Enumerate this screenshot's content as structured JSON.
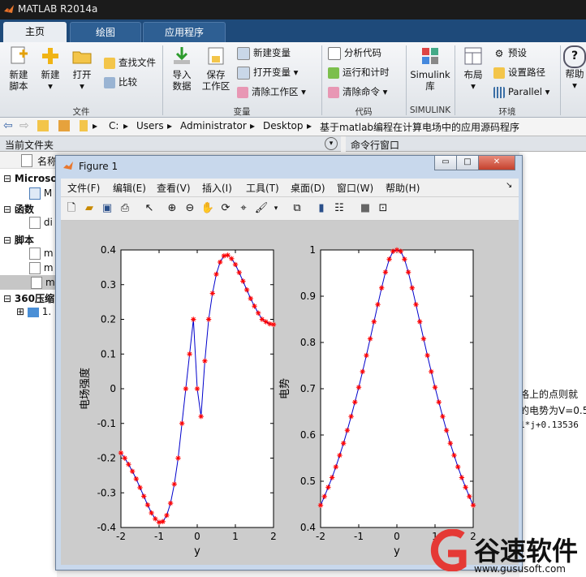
{
  "window": {
    "title": "MATLAB R2014a"
  },
  "tabs": [
    {
      "label": "主页",
      "active": true
    },
    {
      "label": "绘图",
      "active": false
    },
    {
      "label": "应用程序",
      "active": false
    }
  ],
  "ribbon": {
    "file_group": {
      "label": "文件",
      "new_script": "新建\n脚本",
      "new": "新建",
      "open": "打开",
      "find_files": "查找文件",
      "compare": "比较"
    },
    "variable_group": {
      "label": "变量",
      "import": "导入\n数据",
      "save_ws": "保存\n工作区",
      "new_var": "新建变量",
      "open_var": "打开变量",
      "clear_ws": "清除工作区"
    },
    "code_group": {
      "label": "代码",
      "analyze": "分析代码",
      "run_time": "运行和计时",
      "clear_cmd": "清除命令"
    },
    "simulink_group": {
      "label": "SIMULINK",
      "simulink": "Simulink\n库"
    },
    "env_group": {
      "label": "环境",
      "layout": "布局",
      "prefs": "预设",
      "set_path": "设置路径",
      "parallel": "Parallel"
    },
    "help": "帮助"
  },
  "address": {
    "crumbs": [
      "C:",
      "Users",
      "Administrator",
      "Desktop",
      "基于matlab编程在计算电场中的应用源码程序"
    ]
  },
  "left_pane": {
    "header": "当前文件夹",
    "name_col": "名称",
    "items": [
      {
        "label": "Microso"
      },
      {
        "label": "M"
      },
      {
        "label": "函数"
      },
      {
        "label": "di"
      },
      {
        "label": "脚本"
      },
      {
        "label": "m"
      },
      {
        "label": "m"
      },
      {
        "label": "m"
      },
      {
        "label": "360压缩"
      },
      {
        "label": "1."
      }
    ]
  },
  "command_window": {
    "header": "命令行窗口",
    "lines": [
      "格上的点则就",
      "的电势为V=0.5",
      "1*j+0.13536"
    ]
  },
  "figure": {
    "title": "Figure 1",
    "menu": [
      "文件(F)",
      "编辑(E)",
      "查看(V)",
      "插入(I)",
      "工具(T)",
      "桌面(D)",
      "窗口(W)",
      "帮助(H)"
    ],
    "minimize": "▭",
    "maximize": "□",
    "close": "✕"
  },
  "chart_data": [
    {
      "type": "line",
      "xlabel": "y",
      "ylabel": "电场强度",
      "xlim": [
        -2,
        2
      ],
      "ylim": [
        -0.4,
        0.4
      ],
      "xticks": [
        -2,
        -1,
        0,
        1,
        2
      ],
      "yticks": [
        -0.4,
        -0.3,
        -0.2,
        -0.1,
        0,
        0.1,
        0.2,
        0.3,
        0.4
      ],
      "grid": false,
      "line_color": "#0000cc",
      "marker_color": "#ff0000",
      "marker": "*",
      "x": [
        -2.0,
        -1.9,
        -1.8,
        -1.7,
        -1.6,
        -1.5,
        -1.4,
        -1.3,
        -1.2,
        -1.1,
        -1.0,
        -0.9,
        -0.8,
        -0.7,
        -0.6,
        -0.5,
        -0.4,
        -0.3,
        -0.2,
        -0.1,
        0.0,
        0.1,
        0.2,
        0.3,
        0.4,
        0.5,
        0.6,
        0.7,
        0.8,
        0.9,
        1.0,
        1.1,
        1.2,
        1.3,
        1.4,
        1.5,
        1.6,
        1.7,
        1.8,
        1.9,
        2.0
      ],
      "y": [
        -0.185,
        -0.2,
        -0.218,
        -0.238,
        -0.26,
        -0.285,
        -0.31,
        -0.335,
        -0.358,
        -0.375,
        -0.385,
        -0.383,
        -0.365,
        -0.33,
        -0.275,
        -0.2,
        -0.1,
        0.0,
        0.1,
        0.2,
        0.0,
        -0.08,
        0.08,
        0.2,
        0.275,
        0.33,
        0.365,
        0.383,
        0.385,
        0.375,
        0.358,
        0.335,
        0.31,
        0.285,
        0.26,
        0.238,
        0.218,
        0.2,
        0.193,
        0.187,
        0.185
      ]
    },
    {
      "type": "line",
      "xlabel": "y",
      "ylabel": "电势",
      "xlim": [
        -2,
        2
      ],
      "ylim": [
        0.4,
        1.0
      ],
      "xticks": [
        -2,
        -1,
        0,
        1,
        2
      ],
      "yticks": [
        0.4,
        0.5,
        0.6,
        0.7,
        0.8,
        0.9,
        1.0
      ],
      "grid": false,
      "line_color": "#0000cc",
      "marker_color": "#ff0000",
      "marker": "*",
      "x": [
        -2.0,
        -1.9,
        -1.8,
        -1.7,
        -1.6,
        -1.5,
        -1.4,
        -1.3,
        -1.2,
        -1.1,
        -1.0,
        -0.9,
        -0.8,
        -0.7,
        -0.6,
        -0.5,
        -0.4,
        -0.3,
        -0.2,
        -0.1,
        0.0,
        0.1,
        0.2,
        0.3,
        0.4,
        0.5,
        0.6,
        0.7,
        0.8,
        0.9,
        1.0,
        1.1,
        1.2,
        1.3,
        1.4,
        1.5,
        1.6,
        1.7,
        1.8,
        1.9,
        2.0
      ],
      "y": [
        0.448,
        0.467,
        0.487,
        0.508,
        0.531,
        0.556,
        0.582,
        0.61,
        0.64,
        0.671,
        0.703,
        0.737,
        0.772,
        0.808,
        0.845,
        0.882,
        0.918,
        0.952,
        0.98,
        0.997,
        1.0,
        0.997,
        0.98,
        0.952,
        0.918,
        0.882,
        0.845,
        0.808,
        0.772,
        0.737,
        0.703,
        0.671,
        0.64,
        0.61,
        0.582,
        0.556,
        0.531,
        0.508,
        0.487,
        0.467,
        0.448
      ]
    }
  ],
  "watermark": {
    "brand": "谷速软件",
    "url": "www.gususoft.com"
  }
}
